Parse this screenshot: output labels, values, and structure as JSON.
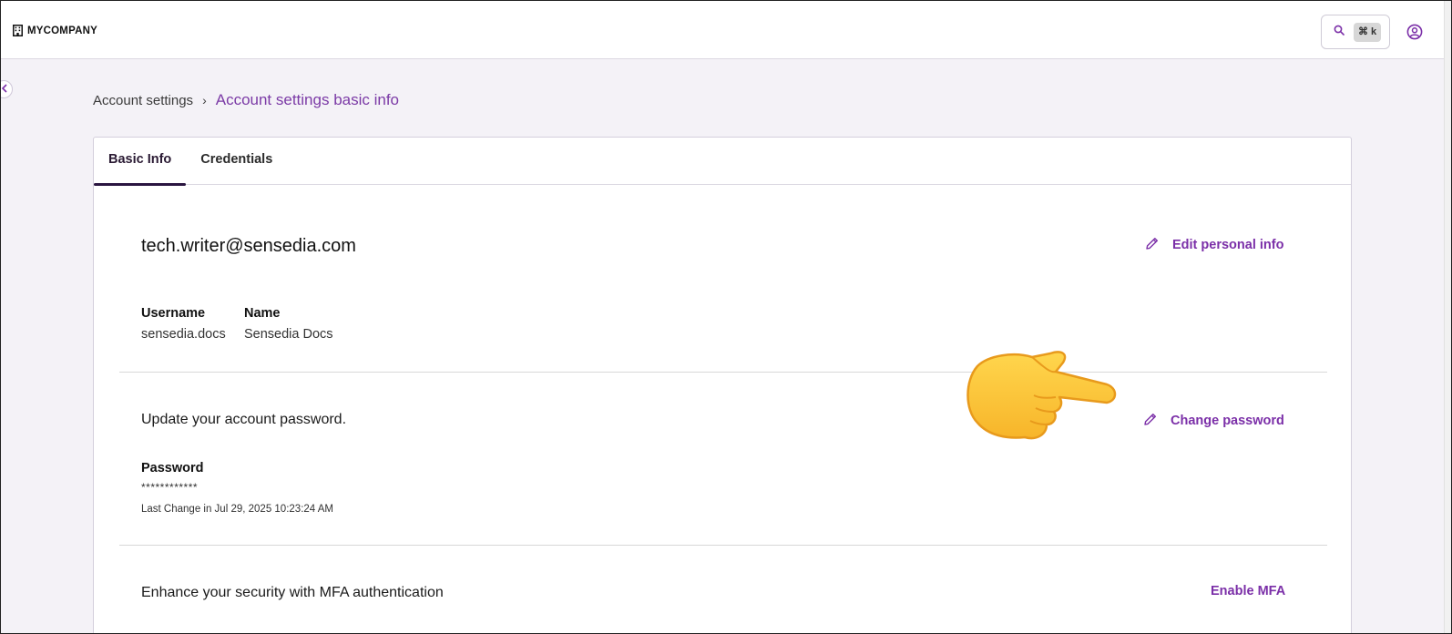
{
  "brand": {
    "name": "MYCOMPANY",
    "icon": "building-icon"
  },
  "search": {
    "shortcut": "⌘ k",
    "icon": "search-icon"
  },
  "user": {
    "icon": "user-circle-icon"
  },
  "sidebar_toggle": {
    "icon": "chevron-left-icon"
  },
  "breadcrumb": {
    "parent": "Account settings",
    "separator": "›",
    "current": "Account settings basic info"
  },
  "tabs": [
    {
      "label": "Basic Info",
      "active": true
    },
    {
      "label": "Credentials",
      "active": false
    }
  ],
  "profile": {
    "email": "tech.writer@sensedia.com",
    "edit_label": "Edit personal info",
    "username_label": "Username",
    "username_value": "sensedia.docs",
    "name_label": "Name",
    "name_value": "Sensedia Docs"
  },
  "password": {
    "heading": "Update your account password.",
    "change_label": "Change password",
    "label": "Password",
    "value": "************",
    "last_change": "Last Change in Jul 29, 2025 10:23:24 AM"
  },
  "mfa": {
    "heading": "Enhance your security with MFA authentication",
    "enable_label": "Enable MFA"
  },
  "colors": {
    "accent": "#7b2fa8",
    "tab_underline": "#2a1540",
    "background": "#f4f2f7"
  },
  "annotation": {
    "icon": "pointing-hand-icon"
  }
}
